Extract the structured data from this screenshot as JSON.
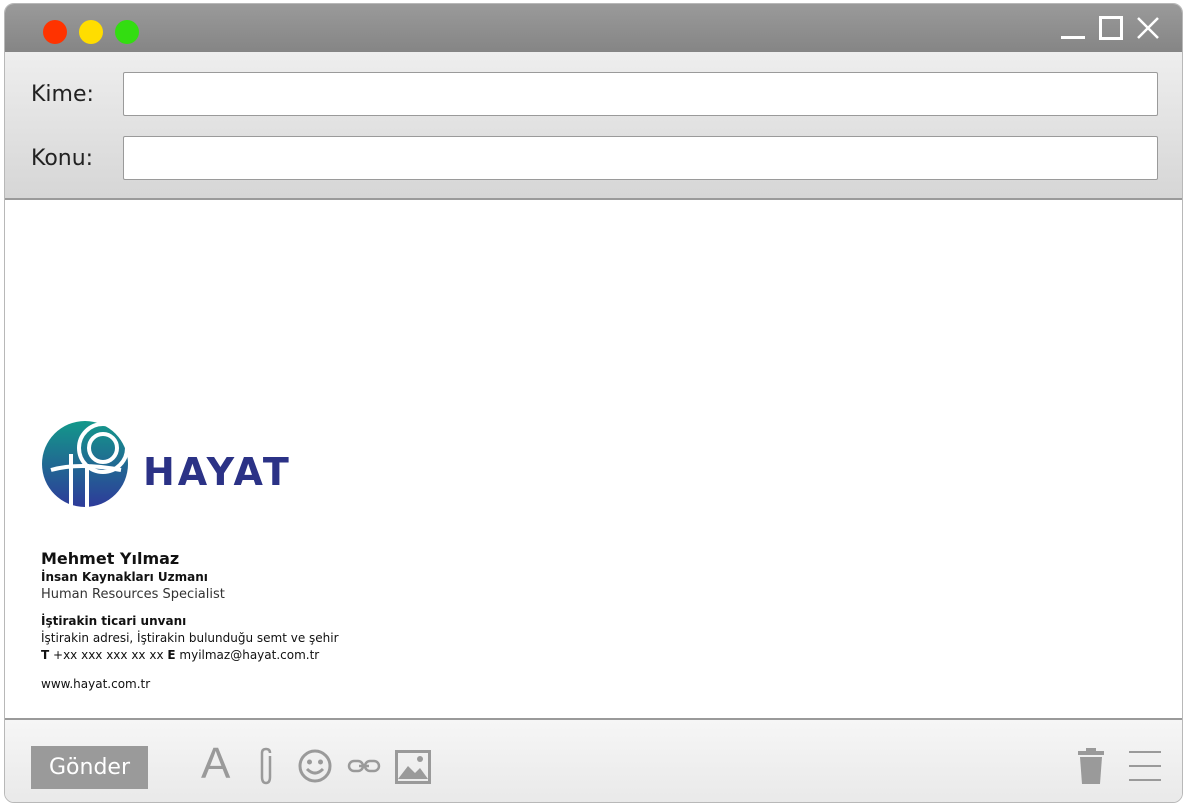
{
  "window": {
    "controls": [
      "minimize-icon",
      "maximize-icon",
      "close-icon"
    ],
    "traffic_lights": [
      "#ff3300",
      "#ffdd00",
      "#33dd11"
    ]
  },
  "compose": {
    "to_label": "Kime:",
    "to_value": "",
    "subject_label": "Konu:",
    "subject_value": ""
  },
  "signature": {
    "brand": "HAYAT",
    "name": "Mehmet Yılmaz",
    "title_tr": "İnsan Kaynakları Uzmanı",
    "title_en": "Human Resources Specialist",
    "company": "İştirakin ticari unvanı",
    "address": "İştirakin adresi, İştirakin bulunduğu semt ve şehir",
    "phone_label": "T",
    "phone": "+xx xxx xxx xx xx",
    "email_label": "E",
    "email": "myilmaz@hayat.com.tr",
    "website": "www.hayat.com.tr",
    "brand_color": "#2b3286",
    "accent_color": "#13988a"
  },
  "toolbar": {
    "send_label": "Gönder",
    "font_glyph": "A",
    "icons": [
      "font-icon",
      "paperclip-icon",
      "smiley-icon",
      "link-icon",
      "image-icon",
      "trash-icon",
      "menu-icon"
    ]
  }
}
